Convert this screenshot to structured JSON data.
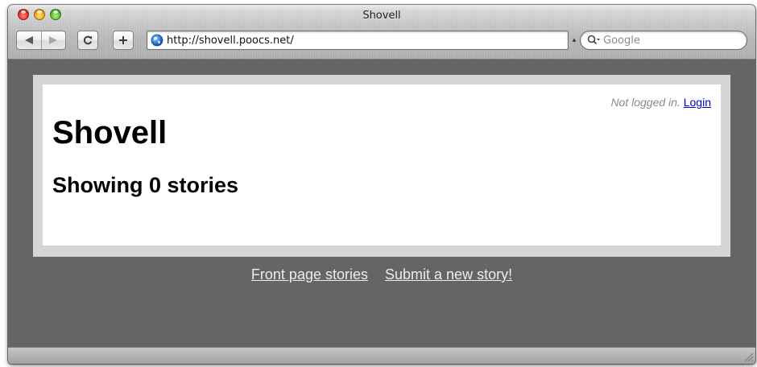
{
  "window": {
    "title": "Shovell"
  },
  "toolbar": {
    "reload_icon": "reload-icon",
    "add_icon": "plus-icon",
    "url": "http://shovell.poocs.net/",
    "search_placeholder": "Google"
  },
  "page": {
    "login_status": "Not logged in.",
    "login_link": "Login",
    "site_title": "Shovell",
    "heading": "Showing 0 stories"
  },
  "footer": {
    "links": [
      "Front page stories",
      "Submit a new story!"
    ]
  },
  "colors": {
    "page_background": "#656565",
    "frame": "#d6d6d6",
    "link": "#0000cc",
    "footer_link": "#ececec"
  }
}
